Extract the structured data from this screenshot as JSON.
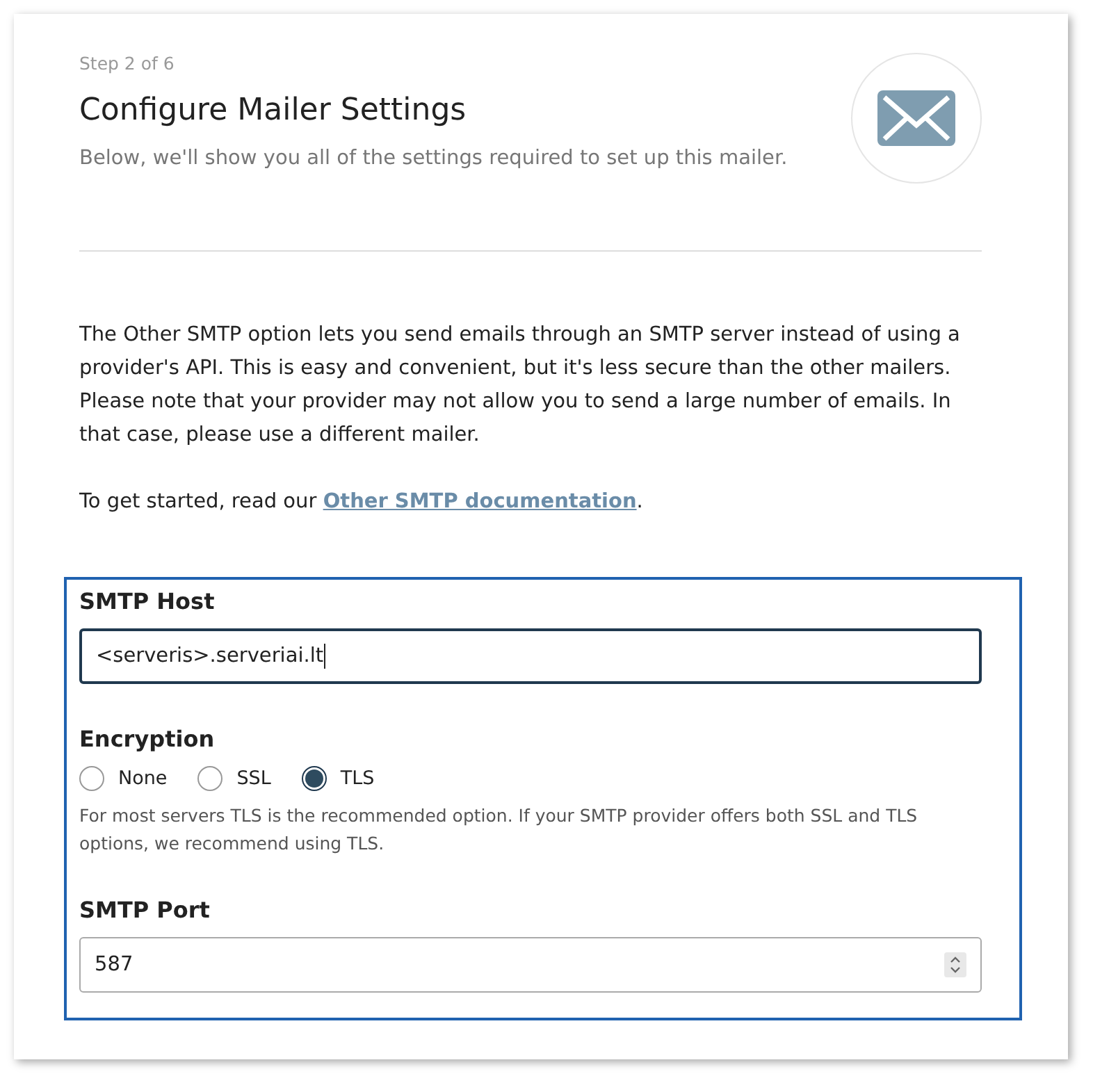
{
  "header": {
    "step": "Step 2 of 6",
    "title": "Configure Mailer Settings",
    "subtitle": "Below, we'll show you all of the settings required to set up this mailer."
  },
  "intro": {
    "text": "The Other SMTP option lets you send emails through an SMTP server instead of using a provider's API. This is easy and convenient, but it's less secure than the other mailers. Please note that your provider may not allow you to send a large number of emails. In that case, please use a different mailer.",
    "start_text": "To get started, read our ",
    "link": "Other SMTP documentation",
    "end_text": "."
  },
  "fields": [
    {
      "kind": "text",
      "label": "SMTP Host",
      "value": "<serveris>.serveriai.lt",
      "focused": true
    },
    {
      "kind": "radio",
      "label": "Encryption",
      "options": [
        {
          "label": "None",
          "selected": false
        },
        {
          "label": "SSL",
          "selected": false
        },
        {
          "label": "TLS",
          "selected": true
        }
      ],
      "help": "For most servers TLS is the recommended option. If your SMTP provider offers both SSL and TLS options, we recommend using TLS."
    },
    {
      "kind": "number",
      "label": "SMTP Port",
      "value": "587",
      "focused": false
    }
  ]
}
